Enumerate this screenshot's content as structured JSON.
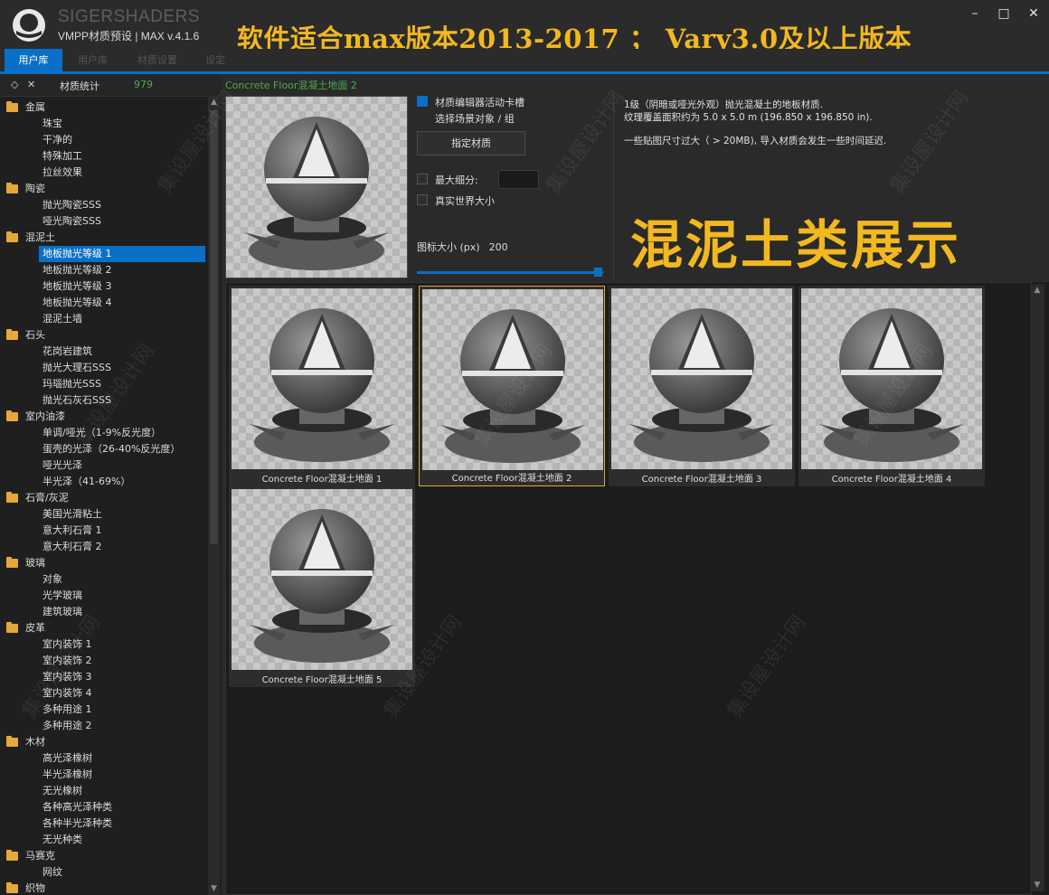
{
  "app": {
    "brand": "SIGERSHADERS",
    "version": "VMPP材质预设 | MAX v.4.1.6",
    "banner": "软件适合max版本2013-2017 ； Vary3.0及以上版本",
    "window_controls": [
      "minimize-icon",
      "maximize-icon",
      "close-icon"
    ]
  },
  "tabs": [
    {
      "label": "用户库",
      "active": true
    },
    {
      "label": "用户库",
      "active": false
    },
    {
      "label": "材质设置",
      "active": false
    },
    {
      "label": "设定",
      "active": false
    }
  ],
  "sidebar": {
    "stats_label": "材质统计",
    "stats_count": "979",
    "tree": [
      {
        "type": "cat",
        "label": "金属"
      },
      {
        "type": "item",
        "label": "珠宝"
      },
      {
        "type": "item",
        "label": "干净的"
      },
      {
        "type": "item",
        "label": "特殊加工"
      },
      {
        "type": "item",
        "label": "拉丝效果"
      },
      {
        "type": "cat",
        "label": "陶瓷"
      },
      {
        "type": "item",
        "label": "抛光陶瓷SSS"
      },
      {
        "type": "item",
        "label": "哑光陶瓷SSS"
      },
      {
        "type": "cat",
        "label": "混泥土"
      },
      {
        "type": "item",
        "label": "地板抛光等级 1",
        "selected": true
      },
      {
        "type": "item",
        "label": "地板抛光等级 2"
      },
      {
        "type": "item",
        "label": "地板抛光等级 3"
      },
      {
        "type": "item",
        "label": "地板抛光等级 4"
      },
      {
        "type": "item",
        "label": "混泥土墙"
      },
      {
        "type": "cat",
        "label": "石头"
      },
      {
        "type": "item",
        "label": "花岗岩建筑"
      },
      {
        "type": "item",
        "label": "抛光大理石SSS"
      },
      {
        "type": "item",
        "label": "玛瑙抛光SSS"
      },
      {
        "type": "item",
        "label": "抛光石灰石SSS"
      },
      {
        "type": "cat",
        "label": "室内油漆"
      },
      {
        "type": "item",
        "label": "单调/哑光（1-9%反光度）"
      },
      {
        "type": "item",
        "label": "蛋壳的光泽（26-40%反光度）"
      },
      {
        "type": "item",
        "label": "哑光光泽"
      },
      {
        "type": "item",
        "label": "半光泽（41-69%）"
      },
      {
        "type": "cat",
        "label": "石膏/灰泥"
      },
      {
        "type": "item",
        "label": "美国光滑粘土"
      },
      {
        "type": "item",
        "label": "意大利石膏 1"
      },
      {
        "type": "item",
        "label": "意大利石膏 2"
      },
      {
        "type": "cat",
        "label": "玻璃"
      },
      {
        "type": "item",
        "label": "对象"
      },
      {
        "type": "item",
        "label": "光学玻璃"
      },
      {
        "type": "item",
        "label": "建筑玻璃"
      },
      {
        "type": "cat",
        "label": "皮革"
      },
      {
        "type": "item",
        "label": "室内装饰 1"
      },
      {
        "type": "item",
        "label": "室内装饰 2"
      },
      {
        "type": "item",
        "label": "室内装饰 3"
      },
      {
        "type": "item",
        "label": "室内装饰 4"
      },
      {
        "type": "item",
        "label": "多种用途 1"
      },
      {
        "type": "item",
        "label": "多种用途 2"
      },
      {
        "type": "cat",
        "label": "木材"
      },
      {
        "type": "item",
        "label": "高光泽橡树"
      },
      {
        "type": "item",
        "label": "半光泽橡树"
      },
      {
        "type": "item",
        "label": "无光橡树"
      },
      {
        "type": "item",
        "label": "各种高光泽种类"
      },
      {
        "type": "item",
        "label": "各种半光泽种类"
      },
      {
        "type": "item",
        "label": "无光种类"
      },
      {
        "type": "cat",
        "label": "马赛克"
      },
      {
        "type": "item",
        "label": "网纹"
      },
      {
        "type": "cat",
        "label": "织物"
      }
    ]
  },
  "preview": {
    "current_name": "Concrete Floor混凝土地面 2",
    "chk_slot": "材质编辑器活动卡槽",
    "chk_select": "选择场景对象 / 组",
    "assign_button": "指定材质",
    "max_subdiv": "最大细分:",
    "real_world": "真实世界大小",
    "icon_size_label": "图标大小 (px)",
    "icon_size_value": "200",
    "icon_size_fraction": 0.95
  },
  "info": {
    "line1": "1级（阴暗或哑光外观）抛光混凝土的地板材质.",
    "line2": "纹理覆盖面积约为 5.0 x 5.0 m (196.850 x 196.850 in).",
    "line3": "一些贴图尺寸过大（ > 20MB), 导入材质会发生一些时间延迟.",
    "overlay": "混泥土类展示"
  },
  "materials": [
    {
      "name": "Concrete Floor混凝土地面 1",
      "selected": false
    },
    {
      "name": "Concrete Floor混凝土地面 2",
      "selected": true
    },
    {
      "name": "Concrete Floor混凝土地面 3",
      "selected": false
    },
    {
      "name": "Concrete Floor混凝土地面 4",
      "selected": false
    },
    {
      "name": "Concrete Floor混凝土地面 5",
      "selected": false
    }
  ],
  "watermark": "集设屋设计网"
}
